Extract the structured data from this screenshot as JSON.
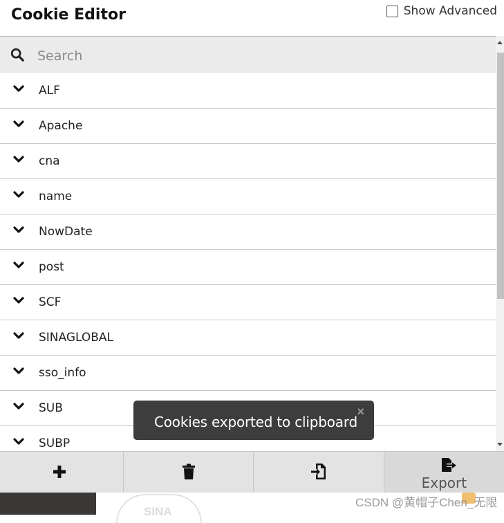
{
  "header": {
    "title": "Cookie Editor",
    "show_advanced_label": "Show Advanced",
    "show_advanced_checked": false
  },
  "search": {
    "placeholder": "Search",
    "icon": "search-icon"
  },
  "cookies": [
    {
      "name": "ALF"
    },
    {
      "name": "Apache"
    },
    {
      "name": "cna"
    },
    {
      "name": "name"
    },
    {
      "name": "NowDate"
    },
    {
      "name": "post"
    },
    {
      "name": "SCF"
    },
    {
      "name": "SINAGLOBAL"
    },
    {
      "name": "sso_info"
    },
    {
      "name": "SUB"
    },
    {
      "name": "SUBP"
    }
  ],
  "toast": {
    "message": "Cookies exported to clipboard",
    "close_symbol": "×"
  },
  "footer": {
    "buttons": [
      {
        "icon": "plus-icon"
      },
      {
        "icon": "trash-icon"
      },
      {
        "icon": "import-icon"
      },
      {
        "icon": "export-icon",
        "label": "Export"
      }
    ]
  },
  "background": {
    "seal_text": "SINA",
    "watermark": "CSDN @黄帽子Chen_无限",
    "watermark_tail": "无阝"
  },
  "colors": {
    "toast_bg": "#3d3d3d",
    "footer_bg": "#e3e3e3",
    "search_bg": "#ebebeb"
  }
}
